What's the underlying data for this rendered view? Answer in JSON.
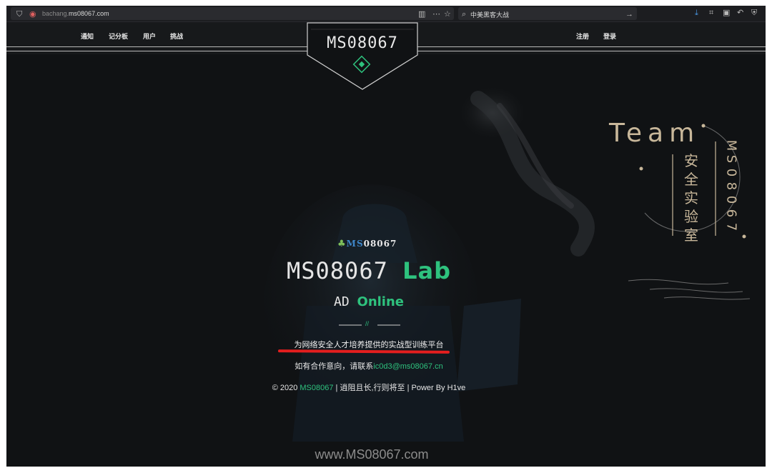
{
  "browser": {
    "url_prefix": "bachang.",
    "url_domain": "ms08067.com",
    "search_value": "中美黑客大战"
  },
  "nav": {
    "left_links": [
      "通知",
      "记分板",
      "用户",
      "挑战"
    ],
    "right_links": [
      "注册",
      "登录"
    ],
    "logo": "MS08067"
  },
  "hero": {
    "mini_logo_prefix": "MS",
    "mini_logo_suffix": "08067",
    "title_main": "MS08067",
    "title_accent": "Lab",
    "subtitle_main": "AD",
    "subtitle_accent": "Online",
    "divider_mark": "//",
    "tagline": "为网络安全人才培养提供的实战型训练平台",
    "contact_prefix": "如有合作意向，请联系",
    "contact_email": "ic0d3@ms08067.cn",
    "copyright_prefix": "© 2020",
    "copyright_brand": "MS08067",
    "copyright_suffix": "| 逍阻且长,行则将至 | Power By H1ve",
    "watermark": "www.MS08067.com"
  },
  "team_badge": {
    "word": "Team",
    "cn_label": "安全实验室",
    "ms_label": "MS08067"
  },
  "colors": {
    "background": "#101214",
    "accent_green": "#2ec27e",
    "badge_gold": "#c8b79a",
    "highlight_red": "#e41e1e"
  }
}
